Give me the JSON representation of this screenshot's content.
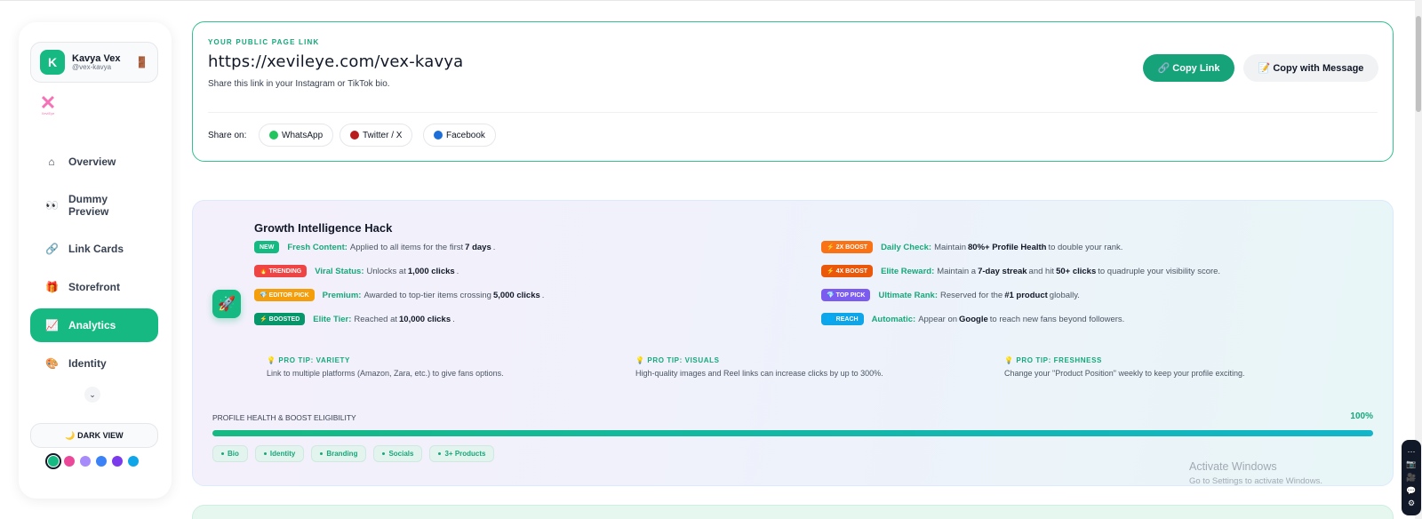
{
  "sidebar": {
    "profile": {
      "initial": "K",
      "name": "Kavya Vex",
      "handle": "@vex-kavya"
    },
    "logo_text": "XeviEye",
    "nav": [
      {
        "icon": "home-icon",
        "glyph": "⌂",
        "label": "Overview",
        "active": false
      },
      {
        "icon": "eyes-icon",
        "glyph": "👀",
        "label": "Dummy Preview",
        "active": false
      },
      {
        "icon": "link-icon",
        "glyph": "🔗",
        "label": "Link Cards",
        "active": false
      },
      {
        "icon": "gift-icon",
        "glyph": "🎁",
        "label": "Storefront",
        "active": false
      },
      {
        "icon": "chart-icon",
        "glyph": "📈",
        "label": "Analytics",
        "active": true
      },
      {
        "icon": "palette-icon",
        "glyph": "🎨",
        "label": "Identity",
        "active": false
      }
    ],
    "dark_view_label": "🌙 DARK VIEW",
    "theme_colors": [
      "#16b981",
      "#ec4899",
      "#a78bfa",
      "#3b82f6",
      "#7c3aed",
      "#0ea5e9"
    ]
  },
  "link_card": {
    "label": "YOUR PUBLIC PAGE LINK",
    "url": "https://xevileye.com/vex-kavya",
    "description": "Share this link in your Instagram or TikTok bio.",
    "copy_link_label": "🔗 Copy Link",
    "copy_message_label": "📝 Copy with Message",
    "share_label": "Share on:",
    "share_buttons": [
      {
        "label": "WhatsApp",
        "color": "#22c55e"
      },
      {
        "label": "Twitter / X",
        "color": "#b91c1c"
      },
      {
        "label": "Facebook",
        "color": "#1d6fd8"
      }
    ]
  },
  "growth": {
    "title": "Growth Intelligence Hack",
    "left_rules": [
      {
        "badge": "NEW",
        "badge_color": "#16b981",
        "key": "Fresh Content:",
        "pre": "Applied to all items for the first",
        "bold": "7 days",
        "post": "."
      },
      {
        "badge": "🔥 TRENDING",
        "badge_color": "#ef4444",
        "key": "Viral Status:",
        "pre": "Unlocks at",
        "bold": "1,000 clicks",
        "post": "."
      },
      {
        "badge": "💎 EDITOR PICK",
        "badge_color": "#f59e0b",
        "key": "Premium:",
        "pre": "Awarded to top-tier items crossing",
        "bold": "5,000 clicks",
        "post": "."
      },
      {
        "badge": "⚡ BOOSTED",
        "badge_color": "#059669",
        "key": "Elite Tier:",
        "pre": "Reached at",
        "bold": "10,000 clicks",
        "post": "."
      }
    ],
    "right_rules": [
      {
        "badge": "⚡ 2X BOOST",
        "badge_color": "#f97316",
        "key": "Daily Check:",
        "pre": "Maintain",
        "bold": "80%+ Profile Health",
        "post": "to double your rank."
      },
      {
        "badge": "⚡ 4X BOOST",
        "badge_color": "#ea580c",
        "key": "Elite Reward:",
        "pre": "Maintain a",
        "bold": "7-day streak",
        "mid": "and hit",
        "bold2": "50+ clicks",
        "post": "to quadruple your visibility score."
      },
      {
        "badge": "💎 TOP PICK",
        "badge_color": "#7c5cf0",
        "key": "Ultimate Rank:",
        "pre": "Reserved for the",
        "bold": "#1 product",
        "post": "globally."
      },
      {
        "badge": "🌐 REACH",
        "badge_color": "#0ea5e9",
        "key": "Automatic:",
        "pre": "Appear on",
        "bold": "Google",
        "post": "to reach new fans beyond followers."
      }
    ],
    "tips": [
      {
        "title": "💡 PRO TIP: VARIETY",
        "desc": "Link to multiple platforms (Amazon, Zara, etc.) to give fans options."
      },
      {
        "title": "💡 PRO TIP: VISUALS",
        "desc": "High-quality images and Reel links can increase clicks by up to 300%."
      },
      {
        "title": "💡 PRO TIP: FRESHNESS",
        "desc": "Change your \"Product Position\" weekly to keep your profile exciting."
      }
    ],
    "health_label": "PROFILE HEALTH & BOOST ELIGIBILITY",
    "health_value": 100,
    "health_text": "100%",
    "chips": [
      "Bio",
      "Identity",
      "Branding",
      "Socials",
      "3+ Products"
    ]
  },
  "watermark": {
    "line1": "Activate Windows",
    "line2": "Go to Settings to activate Windows."
  }
}
